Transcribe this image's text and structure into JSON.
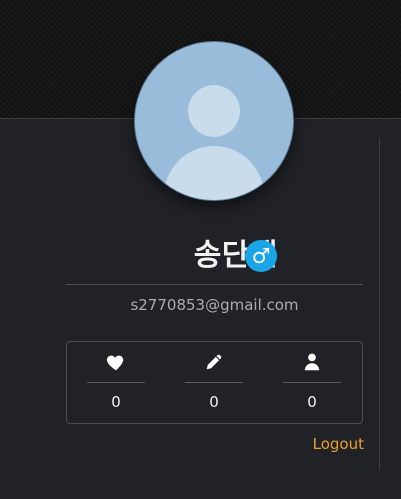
{
  "profile": {
    "name": "송단샘",
    "gender_symbol": "♂",
    "email": "s2770853@gmail.com",
    "avatar_icon": "default-user-avatar-icon",
    "gender_icon": "male-symbol-icon"
  },
  "stats": [
    {
      "icon": "heart-icon",
      "value": "0"
    },
    {
      "icon": "pencil-icon",
      "value": "0"
    },
    {
      "icon": "person-icon",
      "value": "0"
    }
  ],
  "actions": {
    "logout_label": "Logout"
  },
  "colors": {
    "background": "#202227",
    "banner": "#161616",
    "avatar": "#98bcd9",
    "gender_badge": "#1aa6e6",
    "logout": "#e7a02a",
    "text": "#f2f2f2",
    "muted_text": "#a9adb2",
    "border": "#4a4d52"
  }
}
